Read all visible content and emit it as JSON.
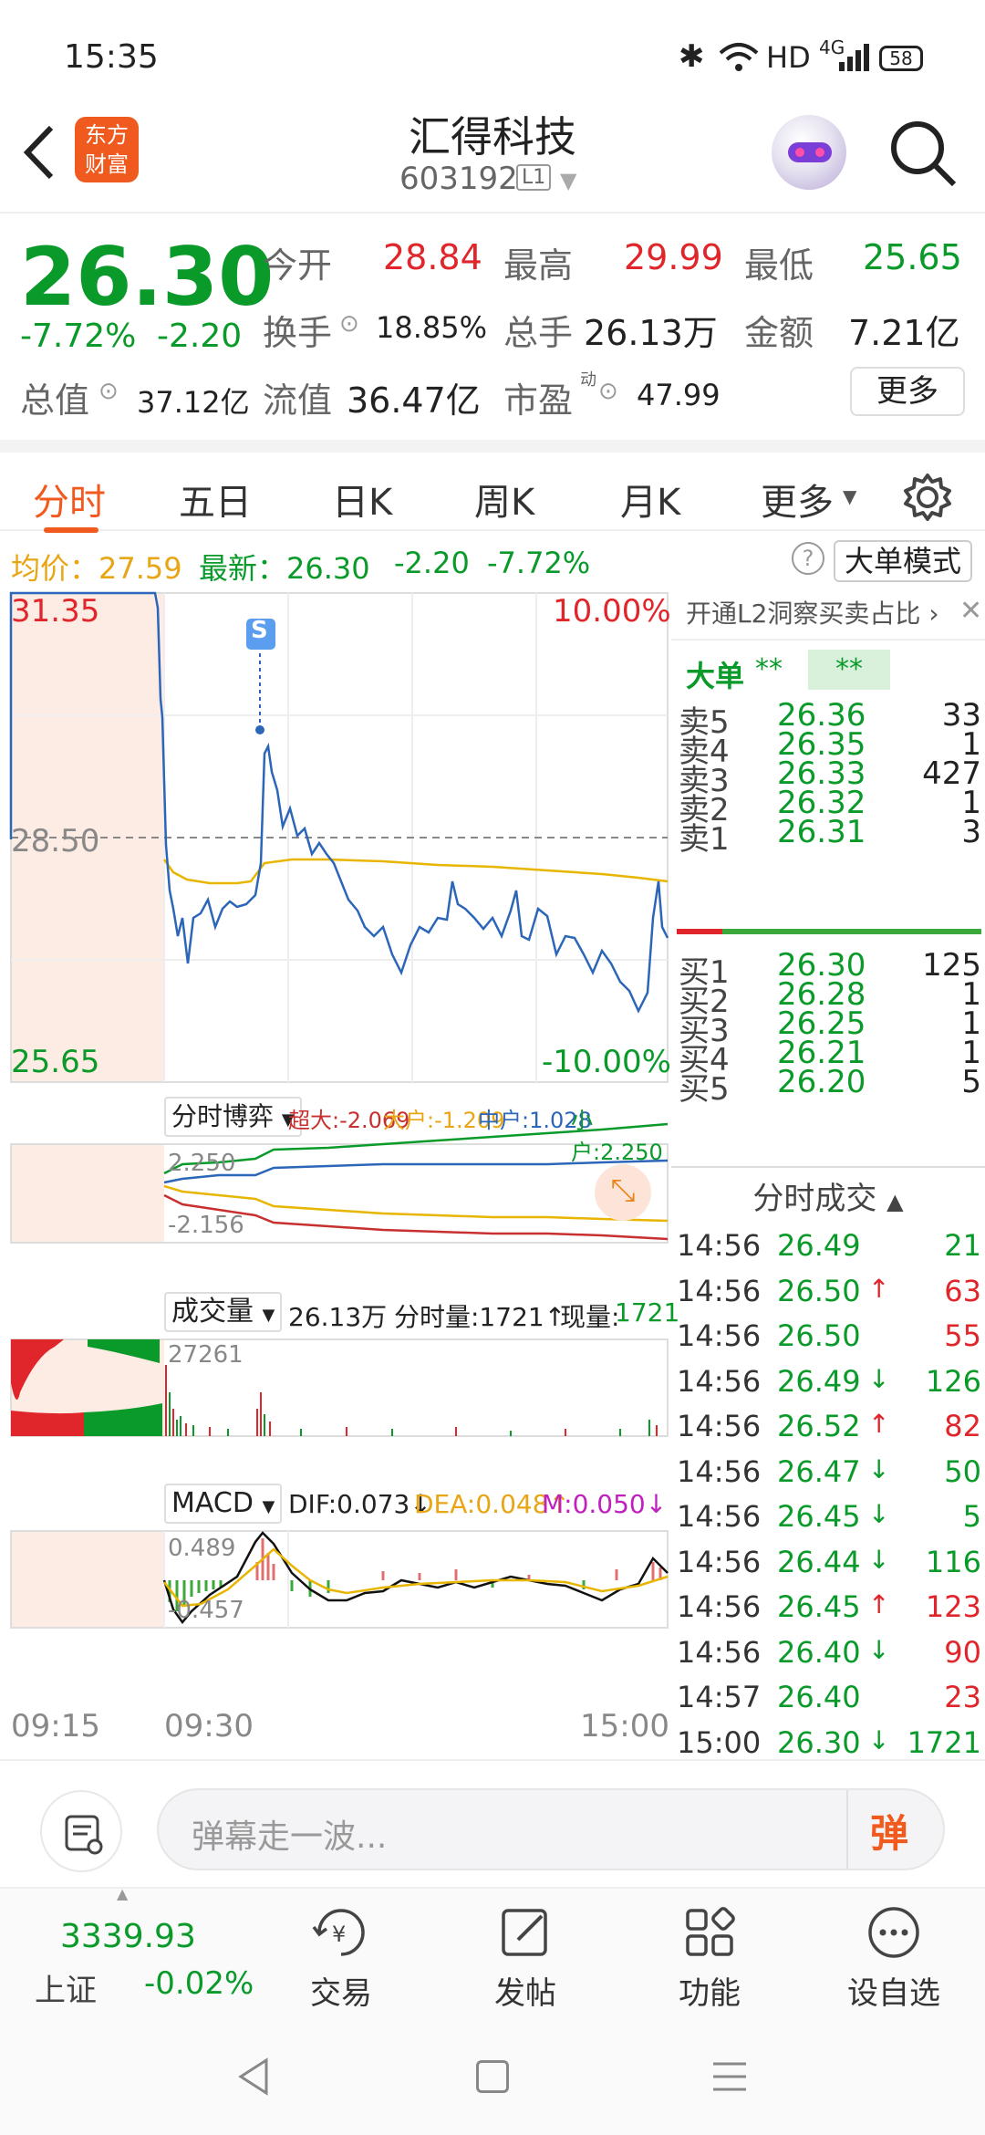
{
  "status": {
    "time": "15:35",
    "network": "HD",
    "signal": "4G",
    "battery": "58"
  },
  "nav": {
    "title": "汇得科技",
    "code": "603192",
    "level": "L1",
    "logo_line1": "东方",
    "logo_line2": "财富"
  },
  "quote": {
    "price": "26.30",
    "pct": "-7.72%",
    "chg": "-2.20",
    "open_label": "今开",
    "open": "28.84",
    "high_label": "最高",
    "high": "29.99",
    "low_label": "最低",
    "low": "25.65",
    "turnover_label": "换手",
    "turnover": "18.85%",
    "vol_label": "总手",
    "vol": "26.13万",
    "amount_label": "金额",
    "amount": "7.21亿",
    "mktcap_label": "总值",
    "mktcap": "37.12亿",
    "float_label": "流值",
    "float": "36.47亿",
    "pe_label": "市盈",
    "pe_sup": "动",
    "pe": "47.99",
    "more": "更多"
  },
  "tabs": [
    "分时",
    "五日",
    "日K",
    "周K",
    "月K",
    "更多"
  ],
  "avg": {
    "avg_label": "均价：27.59",
    "latest_label": "最新：26.30",
    "chg": "-2.20",
    "pct": "-7.72%",
    "mode": "大单模式"
  },
  "chart": {
    "ymax": "31.35",
    "ymid": "28.50",
    "ymin": "25.65",
    "pmax": "10.00%",
    "pmin": "-10.00%",
    "s_marker": "S",
    "game_label": "分时博弈",
    "cd": "超大:-2.069",
    "dh": "大户:-1.209",
    "zh": "中户:1.028",
    "xh": "小户:2.250",
    "game_max": "2.250",
    "game_min": "-2.156",
    "vol_label": "成交量",
    "vol_total": "26.13万",
    "vol_min": "分时量:1721↑",
    "vol_now_label": "现量:",
    "vol_now": "1721",
    "vol_max": "27261",
    "macd_label": "MACD",
    "dif": "DIF:0.073↓",
    "dea": "DEA:0.048↑",
    "m": "M:0.050↓",
    "macd_max": "0.489",
    "macd_min": "-0.457",
    "t0": "09:15",
    "t1": "09:30",
    "t2": "15:00"
  },
  "panel": {
    "l2": "开通L2洞察买卖占比",
    "big_label": "大单",
    "big_v1": "**",
    "big_v2": "**",
    "asks": [
      {
        "l": "卖5",
        "p": "26.36",
        "v": "33"
      },
      {
        "l": "卖4",
        "p": "26.35",
        "v": "1"
      },
      {
        "l": "卖3",
        "p": "26.33",
        "v": "427"
      },
      {
        "l": "卖2",
        "p": "26.32",
        "v": "1"
      },
      {
        "l": "卖1",
        "p": "26.31",
        "v": "3"
      }
    ],
    "bids": [
      {
        "l": "买1",
        "p": "26.30",
        "v": "125"
      },
      {
        "l": "买2",
        "p": "26.28",
        "v": "1"
      },
      {
        "l": "买3",
        "p": "26.25",
        "v": "1"
      },
      {
        "l": "买4",
        "p": "26.21",
        "v": "1"
      },
      {
        "l": "买5",
        "p": "26.20",
        "v": "5"
      }
    ],
    "trades_title": "分时成交",
    "trades": [
      {
        "t": "14:56",
        "p": "26.49",
        "a": "",
        "v": "21",
        "c": "green"
      },
      {
        "t": "14:56",
        "p": "26.50",
        "a": "↑",
        "v": "63",
        "c": "red"
      },
      {
        "t": "14:56",
        "p": "26.50",
        "a": "",
        "v": "55",
        "c": "red"
      },
      {
        "t": "14:56",
        "p": "26.49",
        "a": "↓",
        "v": "126",
        "c": "green"
      },
      {
        "t": "14:56",
        "p": "26.52",
        "a": "↑",
        "v": "82",
        "c": "red"
      },
      {
        "t": "14:56",
        "p": "26.47",
        "a": "↓",
        "v": "50",
        "c": "green"
      },
      {
        "t": "14:56",
        "p": "26.45",
        "a": "↓",
        "v": "5",
        "c": "green"
      },
      {
        "t": "14:56",
        "p": "26.44",
        "a": "↓",
        "v": "116",
        "c": "green"
      },
      {
        "t": "14:56",
        "p": "26.45",
        "a": "↑",
        "v": "123",
        "c": "red"
      },
      {
        "t": "14:56",
        "p": "26.40",
        "a": "↓",
        "v": "90",
        "c": "red"
      },
      {
        "t": "14:57",
        "p": "26.40",
        "a": "",
        "v": "23",
        "c": "red"
      },
      {
        "t": "15:00",
        "p": "26.30",
        "a": "↓",
        "v": "1721",
        "c": "green"
      }
    ]
  },
  "danmu": {
    "placeholder": "弹幕走一波...",
    "btn": "弹"
  },
  "bottom": {
    "index_value": "3339.93",
    "index_name": "上证",
    "index_pct": "-0.02%",
    "items": [
      "交易",
      "发帖",
      "功能",
      "设自选"
    ]
  }
}
